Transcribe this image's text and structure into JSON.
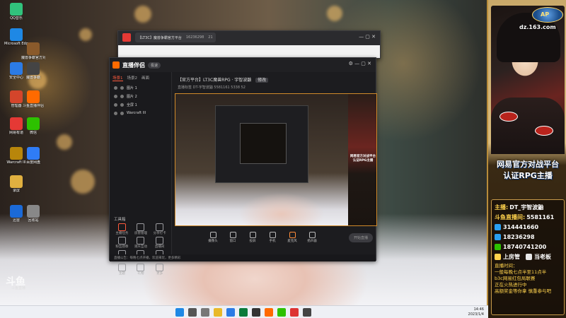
{
  "desktop": {
    "icons": [
      {
        "label": "QQ音乐",
        "color": "#31c27c"
      },
      {
        "label": "Microsoft Edge",
        "color": "#1e88e5"
      },
      {
        "label": "魔兽争霸官方对战平台",
        "color": "#8a5a2b"
      },
      {
        "label": "安全中心",
        "color": "#2c7be5"
      },
      {
        "label": "魔兽争霸",
        "color": "#444"
      },
      {
        "label": "管理器",
        "color": "#d4452b"
      },
      {
        "label": "斗鱼直播伴侣",
        "color": "#ff6a00"
      },
      {
        "label": "网易有道",
        "color": "#e53935"
      },
      {
        "label": "微信",
        "color": "#2dc100"
      },
      {
        "label": "Warcraft III",
        "color": "#b8860b"
      },
      {
        "label": "百度网盘",
        "color": "#2f7cf6"
      },
      {
        "label": "录屏",
        "color": "#e0b040"
      },
      {
        "label": "迅雷",
        "color": "#1b6ad8"
      },
      {
        "label": "回收站",
        "color": "#888"
      }
    ],
    "watermark": {
      "logo": "斗鱼",
      "sub": "斗鱼直播"
    }
  },
  "browser": {
    "tab_title": "【LT3C】魔兽争霸官方平台",
    "room_id": "16236298",
    "viewers": "21"
  },
  "studio": {
    "brand": "直播伴侣",
    "version": "极速",
    "scene_tabs": [
      "场景1",
      "场景2",
      "画面"
    ],
    "sources": [
      "图片 1",
      "图片 2",
      "全屏 1",
      "Warcraft III"
    ],
    "tools_title": "工具箱",
    "tools": [
      "主播任务",
      "房管管理",
      "分享打卡",
      "粉丝勋章",
      "观众互动",
      "直播间",
      "钻粉",
      "弹幕",
      "数据统计",
      "主题",
      "礼物",
      "更多"
    ],
    "room_title": "【官方平台】LT3C魔兽RPG · 宇智波鼬",
    "room_tag": "修改",
    "stats": "直播标签   DT-宇智波鼬   5581161   5338   52",
    "controls": [
      "摄像头",
      "窗口",
      "投屏",
      "手机",
      "麦克风",
      "扬声器"
    ],
    "start_button": "开始直播",
    "status": "直播公告：每晚七点开播，欢迎来玩，更多精彩"
  },
  "banner": {
    "logo_text": "AP",
    "site": "dz.163.com",
    "slogan1": "网易官方对战平台",
    "slogan2": "认证RPG主播",
    "anchor_label": "主播:",
    "anchor_name": "DT_宇智波鼬",
    "room_label": "斗鱼直播间:",
    "room_value": "5581161",
    "qq1": "314441660",
    "qq2": "18236298",
    "phone": "18740741200",
    "guard": "上房管",
    "boss": "当老板",
    "notice": [
      "直播时间：",
      "一般每晚七点半至11点半",
      "b3c网易红包局联赛",
      "正在火热进行中",
      "高额奖金等你拿 慎重参与吧"
    ],
    "colors": {
      "gold": "#ffd34d",
      "accent": "#b8231c"
    }
  },
  "taskbar": {
    "time": "14:46",
    "date": "2023/1/4"
  }
}
